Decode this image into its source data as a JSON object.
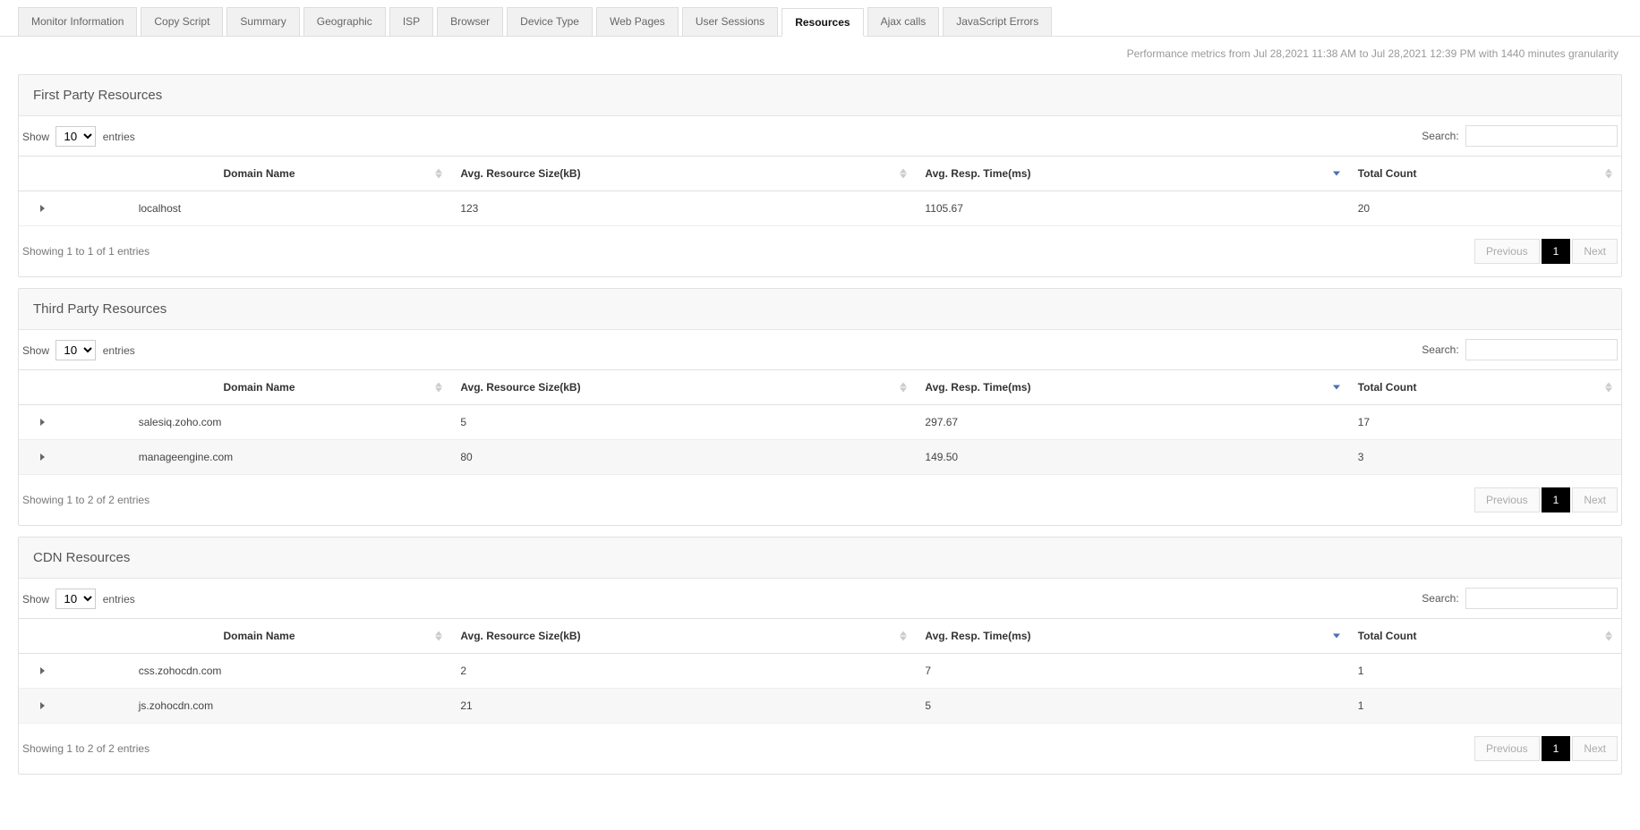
{
  "tabs": [
    {
      "label": "Monitor Information"
    },
    {
      "label": "Copy Script"
    },
    {
      "label": "Summary"
    },
    {
      "label": "Geographic"
    },
    {
      "label": "ISP"
    },
    {
      "label": "Browser"
    },
    {
      "label": "Device Type"
    },
    {
      "label": "Web Pages"
    },
    {
      "label": "User Sessions"
    },
    {
      "label": "Resources",
      "active": true
    },
    {
      "label": "Ajax calls"
    },
    {
      "label": "JavaScript Errors"
    }
  ],
  "metrics_line": "Performance metrics from Jul 28,2021 11:38 AM to Jul 28,2021 12:39 PM with 1440 minutes granularity",
  "labels": {
    "show": "Show",
    "entries": "entries",
    "search": "Search:",
    "previous": "Previous",
    "next": "Next",
    "page1": "1"
  },
  "columns": {
    "domain": "Domain Name",
    "size": "Avg. Resource Size(kB)",
    "time": "Avg. Resp. Time(ms)",
    "count": "Total Count"
  },
  "page_size_options": [
    "10"
  ],
  "sections": {
    "first": {
      "title": "First Party Resources",
      "show_value": "10",
      "rows": [
        {
          "domain": "localhost",
          "size": "123",
          "time": "1105.67",
          "count": "20"
        }
      ],
      "info": "Showing 1 to 1 of 1 entries"
    },
    "third": {
      "title": "Third Party Resources",
      "show_value": "10",
      "rows": [
        {
          "domain": "salesiq.zoho.com",
          "size": "5",
          "time": "297.67",
          "count": "17"
        },
        {
          "domain": "manageengine.com",
          "size": "80",
          "time": "149.50",
          "count": "3"
        }
      ],
      "info": "Showing 1 to 2 of 2 entries"
    },
    "cdn": {
      "title": "CDN Resources",
      "show_value": "10",
      "rows": [
        {
          "domain": "css.zohocdn.com",
          "size": "2",
          "time": "7",
          "count": "1"
        },
        {
          "domain": "js.zohocdn.com",
          "size": "21",
          "time": "5",
          "count": "1"
        }
      ],
      "info": "Showing 1 to 2 of 2 entries"
    }
  }
}
